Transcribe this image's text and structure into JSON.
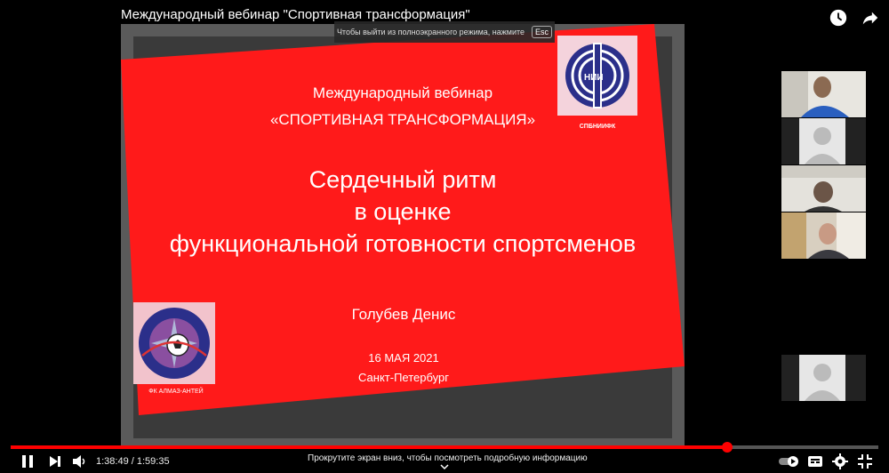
{
  "video": {
    "title": "Международный вебинар \"Спортивная трансформация\"",
    "esc_hint": "Чтобы выйти из полноэкранного режима, нажмите",
    "esc_key": "Esc",
    "current_time": "1:38:49",
    "duration": "1:59:35",
    "time_display": "1:38:49 / 1:59:35",
    "progress_fraction": 0.826,
    "scroll_hint": "Прокрутите экран вниз, чтобы посмотреть подробную информацию",
    "autoplay_on": true
  },
  "slide": {
    "heading_line1": "Международный вебинар",
    "heading_line2": "«СПОРТИВНАЯ ТРАНСФОРМАЦИЯ»",
    "topic_line1": "Сердечный ритм",
    "topic_line2": "в оценке",
    "topic_line3": "функциональной готовности спортсменов",
    "author": "Голубев Денис",
    "date": "16 МАЯ 2021",
    "city": "Санкт-Петербург",
    "logo_top_caption": "СПБНИИФК",
    "logo_top_letters": "НИИ",
    "logo_bottom_caption": "ФК АЛМАЗ-АНТЕЙ",
    "logo_bottom_ring_text": "ФК «АЛМАЗ-АНТЕЙ» САНКТ-ПЕТЕРБУРГ",
    "red_color": "#ff1a1a"
  },
  "participants": [
    {
      "kind": "video"
    },
    {
      "kind": "avatar"
    },
    {
      "kind": "video"
    },
    {
      "kind": "video"
    },
    {
      "kind": "avatar"
    }
  ]
}
